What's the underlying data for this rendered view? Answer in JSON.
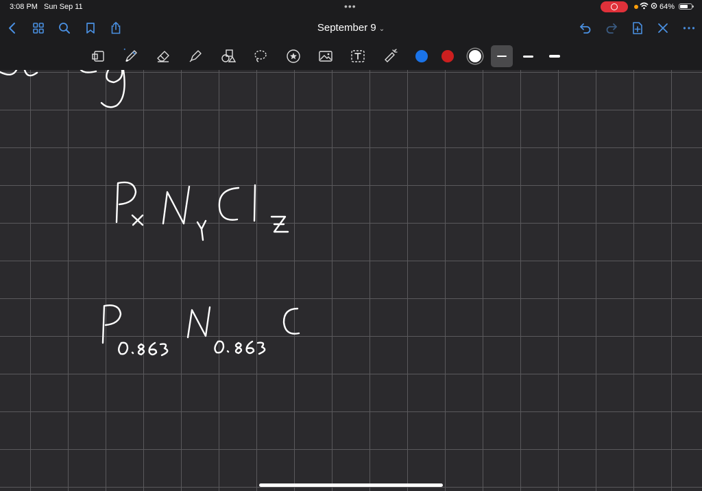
{
  "status_bar": {
    "time": "3:08 PM",
    "date": "Sun Sep 11",
    "battery_percent": "64%",
    "battery_level": 0.64
  },
  "nav_bar": {
    "title": "September 9",
    "left_icons": [
      "back-icon",
      "grid-icon",
      "search-icon",
      "bookmark-icon",
      "share-icon"
    ],
    "right_icons": [
      "undo-icon",
      "redo-icon",
      "add-page-icon",
      "close-icon",
      "more-icon"
    ]
  },
  "toolbar": {
    "tools": [
      "lasso-page-icon",
      "pen-icon",
      "eraser-icon",
      "highlighter-icon",
      "shapes-icon",
      "lasso-icon",
      "sticker-icon",
      "image-icon",
      "text-icon",
      "laser-pointer-icon"
    ],
    "selected_tool": "pen-icon",
    "colors": [
      "#1a73e8",
      "#cc1f1f",
      "#ffffff"
    ],
    "selected_color": "#ffffff",
    "stroke_widths": [
      "thin",
      "medium",
      "thick"
    ],
    "selected_stroke": "thin"
  },
  "colors": {
    "background": "#2b2a2d",
    "grid": "#5a595c",
    "chrome": "#1c1c1e",
    "accent": "#4a90e2",
    "record": "#e0313a"
  },
  "canvas": {
    "handwriting_lines": [
      "P_x N_y Cl_z",
      "P_0.863 N_0.863 C"
    ],
    "handwritten_subscripts": [
      "0.863",
      "0.863"
    ]
  }
}
